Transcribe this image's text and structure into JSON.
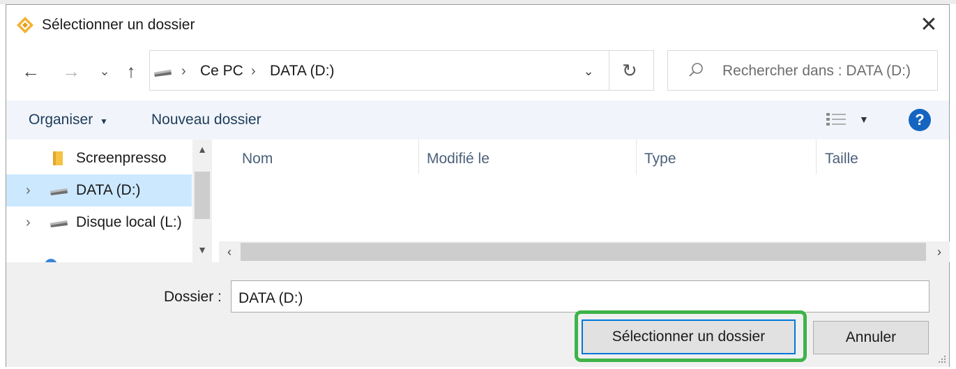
{
  "window": {
    "title": "Sélectionner un dossier"
  },
  "nav": {
    "breadcrumb": [
      "Ce PC",
      "DATA (D:)"
    ],
    "search_placeholder": "Rechercher dans : DATA (D:)"
  },
  "toolbar": {
    "organize_label": "Organiser",
    "new_folder_label": "Nouveau dossier"
  },
  "navpane": {
    "items": [
      {
        "label": "Screenpresso",
        "icon": "folder-icon"
      },
      {
        "label": "DATA (D:)",
        "icon": "drive-icon",
        "selected": true
      },
      {
        "label": "Disque local (L:)",
        "icon": "drive-icon"
      }
    ]
  },
  "content": {
    "columns": [
      "Nom",
      "Modifié le",
      "Type",
      "Taille"
    ],
    "rows": []
  },
  "footer": {
    "folder_label": "Dossier :",
    "folder_value": "DATA (D:)",
    "select_label": "Sélectionner un dossier",
    "cancel_label": "Annuler"
  },
  "colors": {
    "highlight": "#3eb349",
    "help": "#1565c0",
    "selection": "#cce8ff",
    "accent": "#0078d7"
  }
}
